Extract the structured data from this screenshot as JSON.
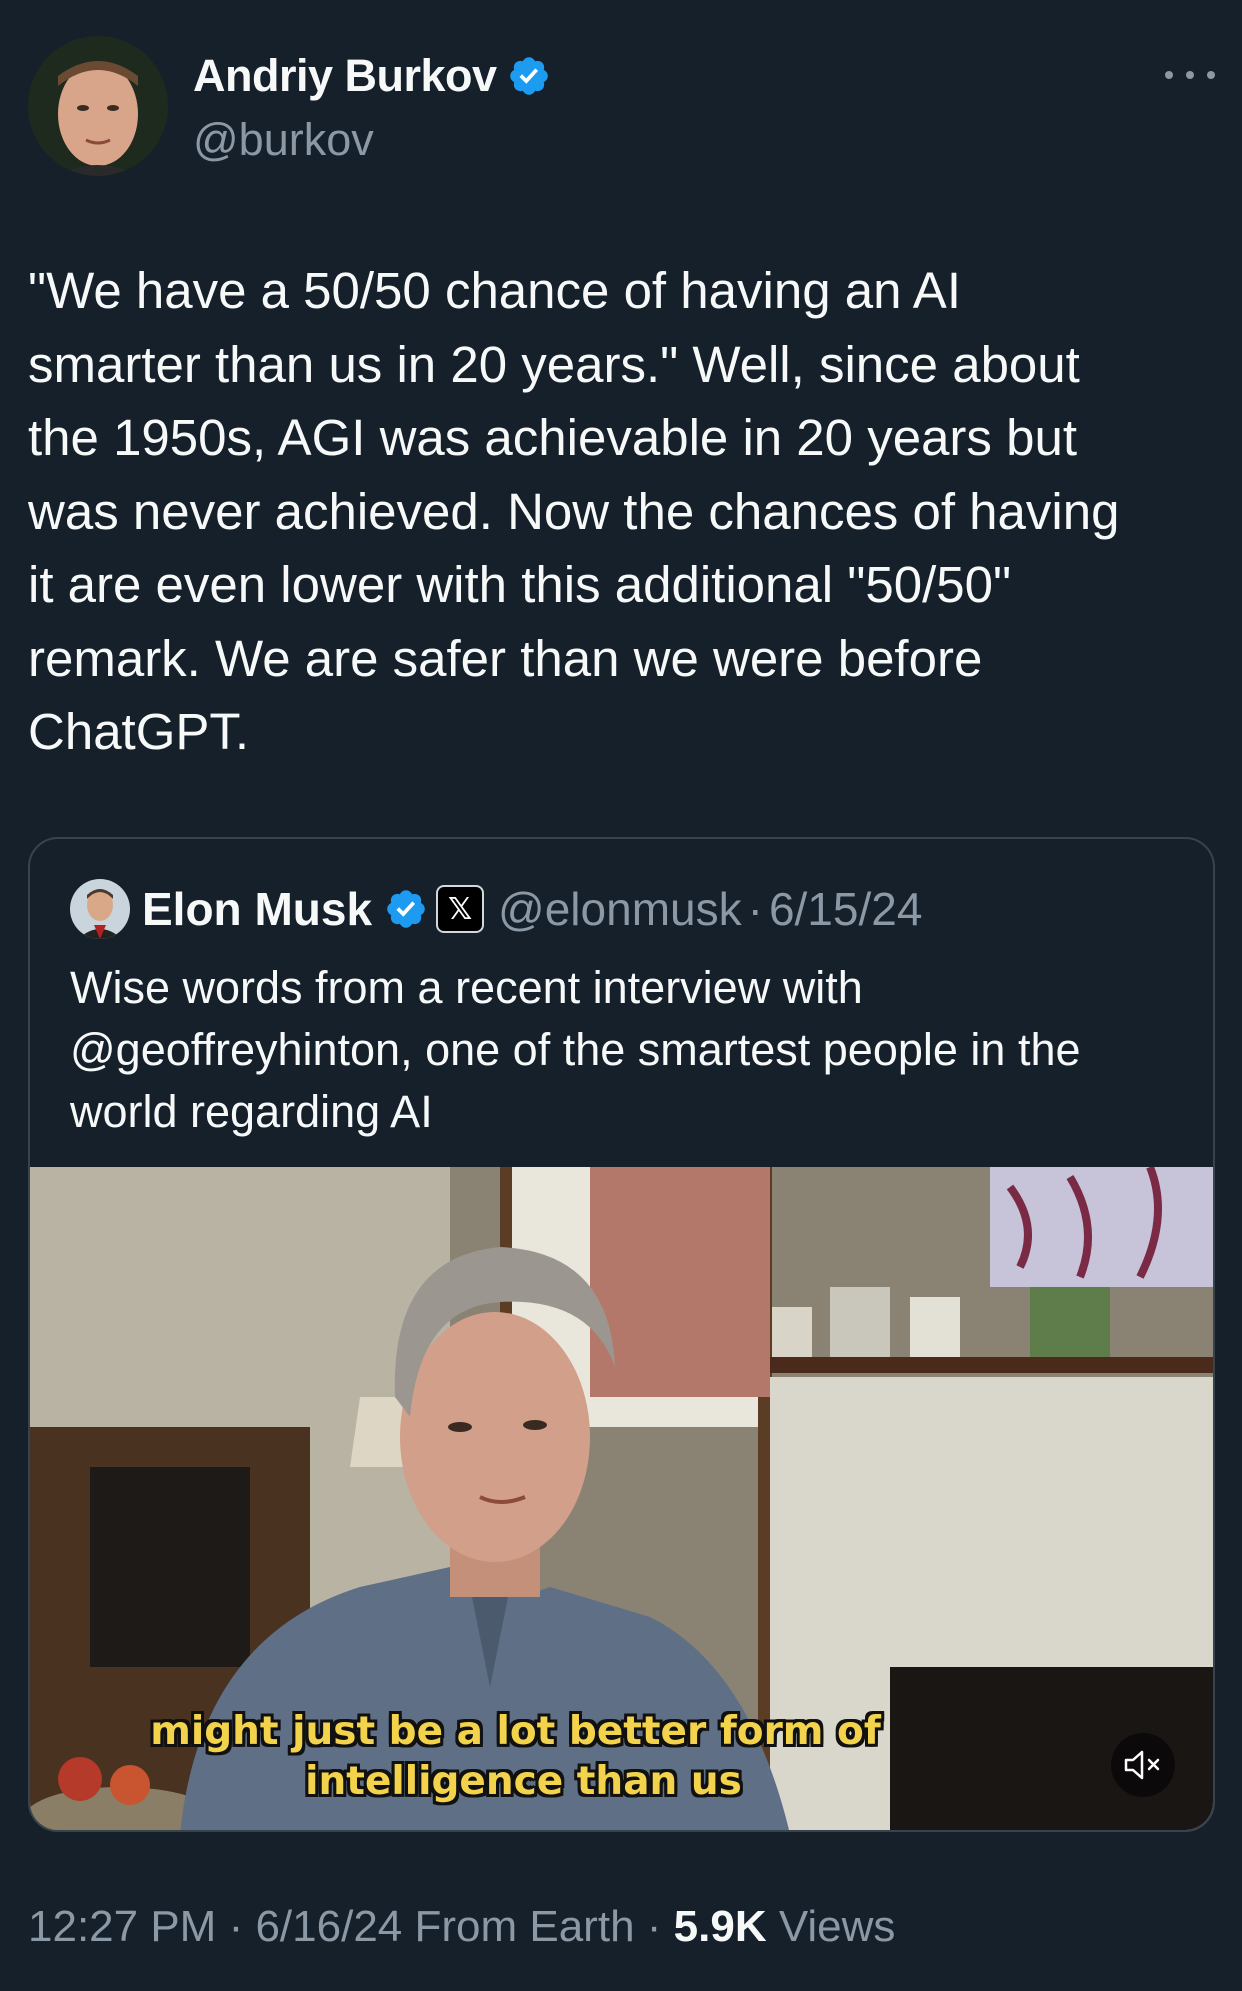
{
  "author": {
    "display_name": "Andriy Burkov",
    "handle": "@burkov"
  },
  "tweet": {
    "text": "\"We have a 50/50 chance of having an AI\nsmarter than us in 20 years.\" Well, since about\nthe 1950s, AGI was achievable in 20 years but\nwas never achieved. Now the chances of having\nit are even lower with this additional \"50/50\"\nremark. We are safer than we were before\nChatGPT."
  },
  "quoted": {
    "display_name": "Elon Musk",
    "affiliate_badge": "𝕏",
    "handle": "@elonmusk",
    "separator": "·",
    "date": "6/15/24",
    "text": "Wise words from a recent interview with\n@geoffreyhinton, one of the smartest people in the\nworld regarding AI",
    "video": {
      "caption_line1": "might just be a lot better form of",
      "caption_line2": "intelligence than us",
      "mute_icon": "speaker-muted-icon"
    }
  },
  "meta": {
    "time": "12:27 PM",
    "sep1": " · ",
    "date": "6/16/24",
    "location": " From Earth",
    "sep2": " · ",
    "views_count": "5.9K",
    "views_label": " Views"
  },
  "colors": {
    "background": "#15202b",
    "text_primary": "#f7f9f9",
    "text_secondary": "#8b98a5",
    "verified_blue": "#1d9bf0",
    "border": "#38444d",
    "caption_yellow": "#f2d34b"
  }
}
